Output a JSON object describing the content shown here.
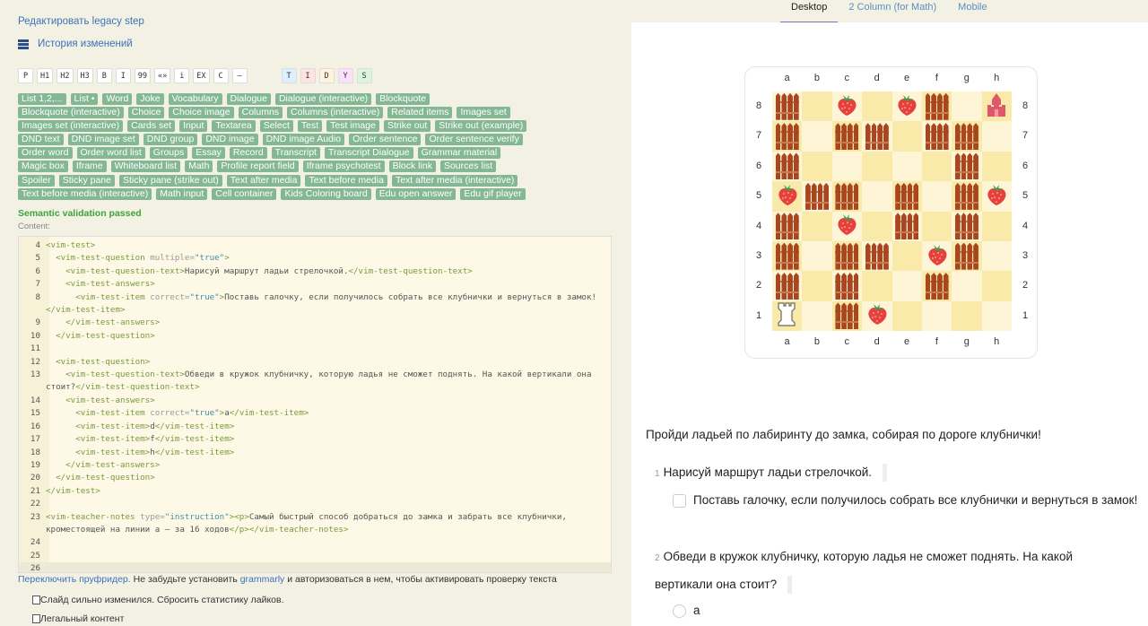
{
  "edit_link": "Редактировать legacy step",
  "history_link": "История изменений",
  "toolbar": [
    "P",
    "H1",
    "H2",
    "H3",
    "B",
    "I",
    "99",
    "«»",
    "i",
    "EX",
    "C",
    "—"
  ],
  "style_buttons": [
    {
      "label": "T",
      "color": "#dcefff"
    },
    {
      "label": "I",
      "color": "#ffe3e3"
    },
    {
      "label": "D",
      "color": "#fff3dd"
    },
    {
      "label": "Y",
      "color": "#fbe0fb"
    },
    {
      "label": "S",
      "color": "#ddf5df"
    }
  ],
  "tag_rows": [
    [
      "List 1,2,...",
      "List •",
      "Word",
      "Joke",
      "Vocabulary",
      "Dialogue",
      "Dialogue (interactive)",
      "Blockquote"
    ],
    [
      "Blockquote (interactive)",
      "Choice",
      "Choice image",
      "Columns",
      "Columns (interactive)",
      "Related items",
      "Images set"
    ],
    [
      "Images set (interactive)",
      "Cards set",
      "Input",
      "Textarea",
      "Select",
      "Test",
      "Test image",
      "Strike out",
      "Strike out (example)"
    ],
    [
      "DND text",
      "DND image set",
      "DND group",
      "DND image",
      "DND image Audio",
      "Order sentence",
      "Order sentence verify"
    ],
    [
      "Order word",
      "Order word list",
      "Groups",
      "Essay",
      "Record",
      "Transcript",
      "Transcript Dialogue",
      "Grammar material"
    ],
    [
      "Magic box",
      "Iframe",
      "Whiteboard list",
      "Math",
      "Profile report field",
      "Iframe psychotest",
      "Block link",
      "Sources list"
    ],
    [
      "Spoiler",
      "Sticky pane",
      "Sticky pane (strike out)",
      "Text after media",
      "Text before media",
      "Text after media (interactive)"
    ],
    [
      "Text before media (interactive)",
      "Math input",
      "Cell container",
      "Kids Coloring board",
      "Edu open answer",
      "Edu gif player"
    ]
  ],
  "validation": "Semantic validation passed",
  "content_label": "Content:",
  "code_lines": [
    {
      "n": "4",
      "text": "<vim-test>"
    },
    {
      "n": "5",
      "text": "  <vim-test-question multiple=\"true\">"
    },
    {
      "n": "6",
      "text": "    <vim-test-question-text>Нарисуй маршрут ладьи стрелочкой.</vim-test-question-text>"
    },
    {
      "n": "7",
      "text": "    <vim-test-answers>"
    },
    {
      "n": "8",
      "text": "      <vim-test-item correct=\"true\">Поставь галочку, если получилось собрать все клубнички и вернуться в замок!</vim-test-item>"
    },
    {
      "n": "9",
      "text": "    </vim-test-answers>"
    },
    {
      "n": "10",
      "text": "  </vim-test-question>"
    },
    {
      "n": "11",
      "text": ""
    },
    {
      "n": "12",
      "text": "  <vim-test-question>"
    },
    {
      "n": "13",
      "text": "    <vim-test-question-text>Обведи в кружок клубничку, которую ладья не сможет поднять. На какой вертикали она стоит?</vim-test-question-text>"
    },
    {
      "n": "14",
      "text": "    <vim-test-answers>"
    },
    {
      "n": "15",
      "text": "      <vim-test-item correct=\"true\">a</vim-test-item>"
    },
    {
      "n": "16",
      "text": "      <vim-test-item>d</vim-test-item>"
    },
    {
      "n": "17",
      "text": "      <vim-test-item>f</vim-test-item>"
    },
    {
      "n": "18",
      "text": "      <vim-test-item>h</vim-test-item>"
    },
    {
      "n": "19",
      "text": "    </vim-test-answers>"
    },
    {
      "n": "20",
      "text": "  </vim-test-question>"
    },
    {
      "n": "21",
      "text": "</vim-test>"
    },
    {
      "n": "22",
      "text": ""
    },
    {
      "n": "23",
      "text": "<vim-teacher-notes type=\"instruction\"><p>Самый быстрый способ добраться до замка и забрать все клубнички, кроместоящей на линии a – за 16 ходов</p></vim-teacher-notes>"
    },
    {
      "n": "24",
      "text": ""
    },
    {
      "n": "25",
      "text": ""
    },
    {
      "n": "26",
      "text": ""
    }
  ],
  "proof": {
    "link": "Переключить пруфридер.",
    "text1": " Не забудьте установить ",
    "grammarly": "grammarly",
    "text2": " и авторизоваться в нем, чтобы активировать проверку текста"
  },
  "checkbox_reset": "Слайд сильно изменился. Сбросить статистику лайков.",
  "checkbox_legal": "Легальный контент",
  "preview_tabs": [
    {
      "label": "Desktop",
      "active": true
    },
    {
      "label": "2 Column (for Math)",
      "active": false
    },
    {
      "label": "Mobile",
      "active": false
    }
  ],
  "board": {
    "files": [
      "a",
      "b",
      "c",
      "d",
      "e",
      "f",
      "g",
      "h"
    ],
    "ranks": [
      "8",
      "7",
      "6",
      "5",
      "4",
      "3",
      "2",
      "1"
    ],
    "legend": {
      "F": "fence",
      "S": "strawberry",
      "C": "castle",
      "R": "rook",
      ".": "empty"
    },
    "rows": [
      "F.S.SF.C",
      "F.FF.FF.",
      "F.....F.",
      "SFF.F.FS",
      "F.S.F.F.",
      "F.FF.SF.",
      "F.F..F..",
      "R.FS...."
    ],
    "colors": {
      "light": "#fdf5d6",
      "dark": "#f9eaa9",
      "fence": "#a9461f",
      "strawberry": "#e8403f",
      "castle": "#e0566a"
    }
  },
  "task_title": "Пройди ладьей по лабиринту до замка, собирая по дороге клубнички!",
  "questions": [
    {
      "num": "1",
      "text": "Нарисуй маршрут ладьи стрелочкой.",
      "answers": [
        "Поставь галочку, если получилось собрать все клубнички и вернуться в замок!"
      ]
    },
    {
      "num": "2",
      "text": "Обведи в кружок клубничку, которую ладья не сможет поднять. На какой вертикали она стоит?",
      "answers": [
        "a"
      ]
    }
  ]
}
